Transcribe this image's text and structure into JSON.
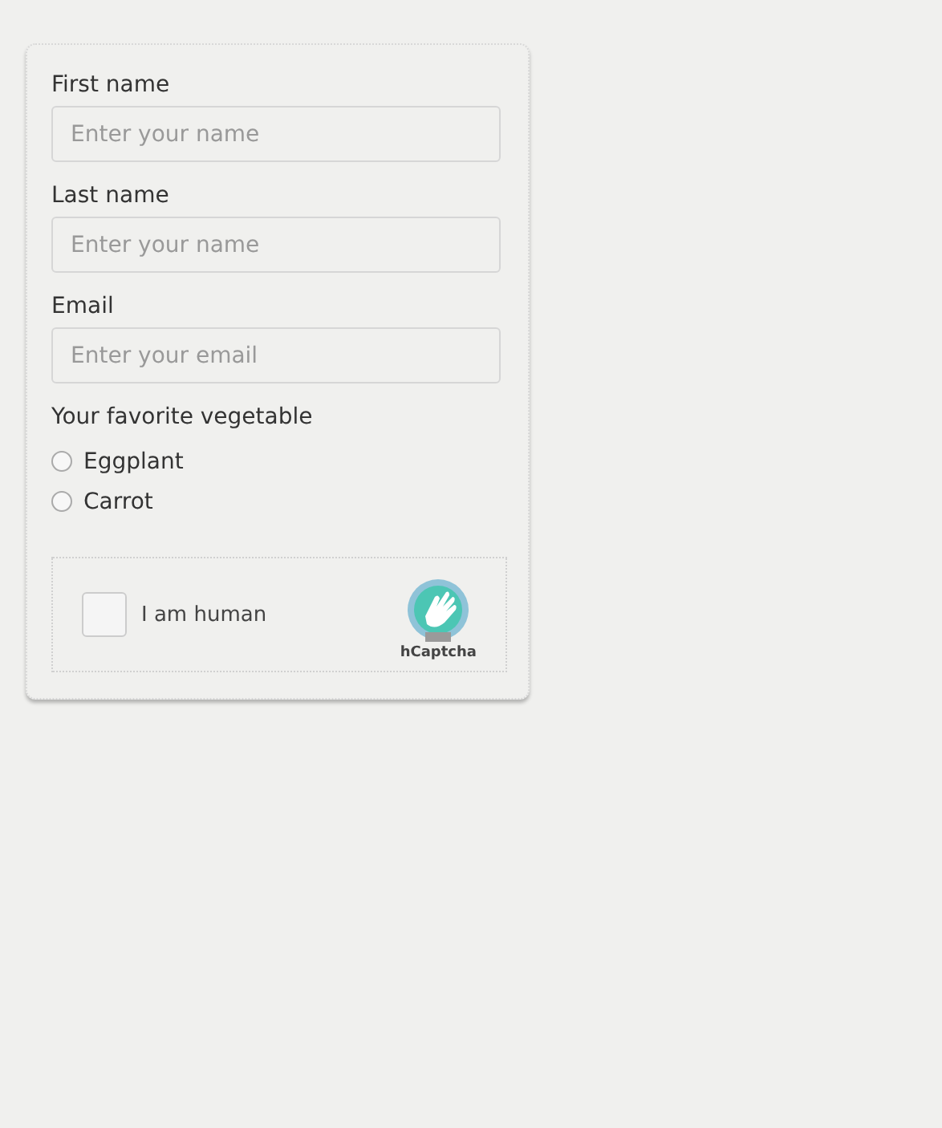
{
  "fields": [
    {
      "label": "First name",
      "placeholder": "Enter your name"
    },
    {
      "label": "Last name",
      "placeholder": "Enter your name"
    },
    {
      "label": "Email",
      "placeholder": "Enter your email"
    }
  ],
  "vegetable": {
    "label": "Your favorite vegetable",
    "options": [
      {
        "label": "Eggplant",
        "selected": false
      },
      {
        "label": "Carrot",
        "selected": false
      }
    ]
  },
  "captcha": {
    "label": "I am human",
    "checked": false,
    "brand": "hCaptcha"
  }
}
